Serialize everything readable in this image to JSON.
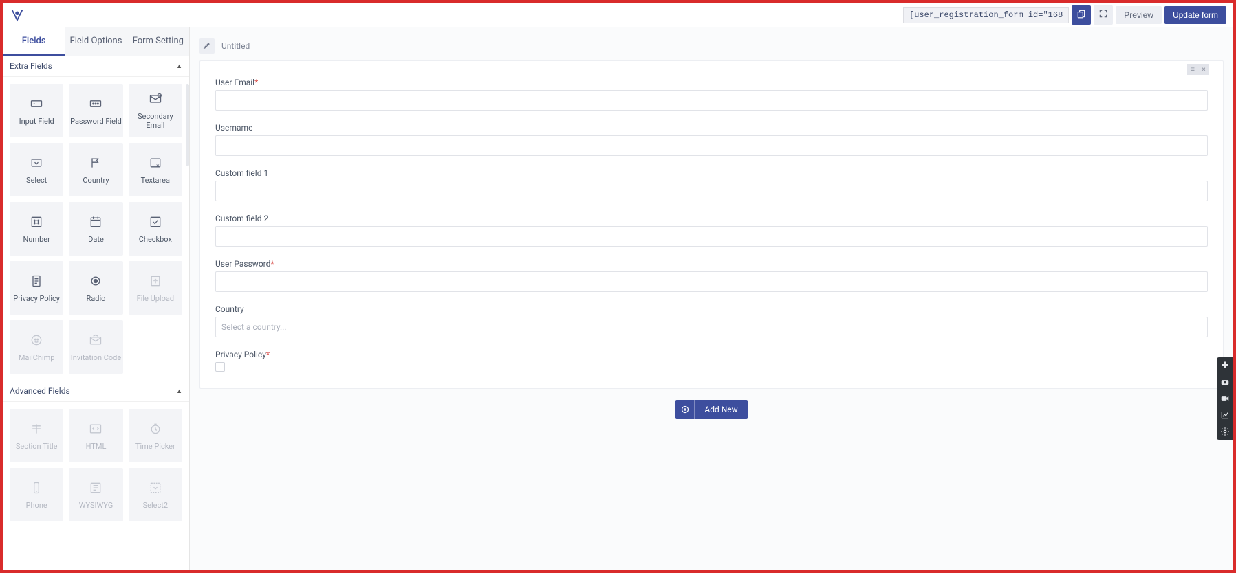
{
  "topbar": {
    "shortcode": "[user_registration_form id=\"168",
    "preview": "Preview",
    "update": "Update form"
  },
  "tabs": {
    "fields": "Fields",
    "options": "Field Options",
    "settings": "Form Setting"
  },
  "sections": {
    "extra": "Extra Fields",
    "advanced": "Advanced Fields"
  },
  "extra": [
    {
      "label": "Input Field",
      "icon": "input",
      "disabled": false
    },
    {
      "label": "Password Field",
      "icon": "password",
      "disabled": false
    },
    {
      "label": "Secondary Email",
      "icon": "email2",
      "disabled": false
    },
    {
      "label": "Select",
      "icon": "select",
      "disabled": false
    },
    {
      "label": "Country",
      "icon": "flag",
      "disabled": false
    },
    {
      "label": "Textarea",
      "icon": "textarea",
      "disabled": false
    },
    {
      "label": "Number",
      "icon": "number",
      "disabled": false
    },
    {
      "label": "Date",
      "icon": "date",
      "disabled": false
    },
    {
      "label": "Checkbox",
      "icon": "checkbox",
      "disabled": false
    },
    {
      "label": "Privacy Policy",
      "icon": "doc",
      "disabled": false
    },
    {
      "label": "Radio",
      "icon": "radio",
      "disabled": false
    },
    {
      "label": "File Upload",
      "icon": "upload",
      "disabled": true
    },
    {
      "label": "MailChimp",
      "icon": "mailchimp",
      "disabled": true
    },
    {
      "label": "Invitation Code",
      "icon": "invite",
      "disabled": true
    }
  ],
  "advanced": [
    {
      "label": "Section Title",
      "icon": "section",
      "disabled": true
    },
    {
      "label": "HTML",
      "icon": "html",
      "disabled": true
    },
    {
      "label": "Time Picker",
      "icon": "time",
      "disabled": true
    },
    {
      "label": "Phone",
      "icon": "phone",
      "disabled": true
    },
    {
      "label": "WYSIWYG",
      "icon": "wys",
      "disabled": true
    },
    {
      "label": "Select2",
      "icon": "select2",
      "disabled": true
    }
  ],
  "form": {
    "title": "Untitled",
    "fields": [
      {
        "label": "User Email",
        "required": true,
        "type": "text"
      },
      {
        "label": "Username",
        "required": false,
        "type": "text"
      },
      {
        "label": "Custom field 1",
        "required": false,
        "type": "text"
      },
      {
        "label": "Custom field 2",
        "required": false,
        "type": "text"
      },
      {
        "label": "User Password",
        "required": true,
        "type": "text"
      },
      {
        "label": "Country",
        "required": false,
        "type": "select",
        "placeholder": "Select a country..."
      },
      {
        "label": "Privacy Policy",
        "required": true,
        "type": "checkbox"
      }
    ],
    "add_new": "Add New"
  }
}
